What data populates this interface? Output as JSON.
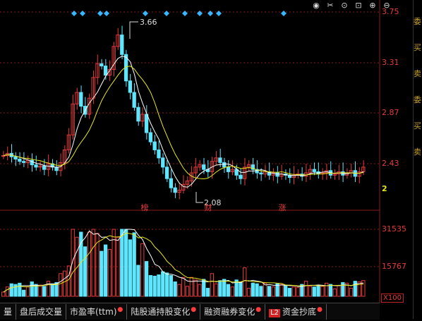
{
  "toolbar": {
    "icons": [
      "eye-icon",
      "scissors-icon",
      "play-icon",
      "bag-icon",
      "plus-icon",
      "minus-icon"
    ],
    "glyphs": [
      "◉",
      "✂",
      "⊙",
      "⊡",
      "⊕",
      "⊖"
    ]
  },
  "price_axis": {
    "labels": [
      "3.75",
      "3.31",
      "2.87",
      "2.43"
    ]
  },
  "volume_axis": {
    "labels": [
      "31535",
      "15767"
    ],
    "unit_badge": "X100"
  },
  "annotations": {
    "high": "3.66",
    "low": "2.08"
  },
  "markers": {
    "bang": "榜",
    "cai": "财",
    "zhang": "涨"
  },
  "price_partial": "2",
  "tabs": [
    {
      "label": "量",
      "dot": false
    },
    {
      "label": "盘后成交量",
      "dot": false
    },
    {
      "label": "市盈率(ttm)",
      "dot": true
    },
    {
      "label": "陆股通持股变化",
      "dot": true
    },
    {
      "label": "融资融券变化",
      "dot": true
    },
    {
      "label": "资金抄底",
      "dot": true,
      "badge": "L2"
    }
  ],
  "right_strip_chars": [
    "委",
    "买",
    "卖",
    "委",
    "买",
    "卖"
  ],
  "colors": {
    "up": "#e83a3a",
    "down": "#5ee6ff",
    "ma_short": "#ffffff",
    "ma_long": "#e8e81a",
    "grid": "#8b1a1a",
    "signal": "#38b6ff"
  }
}
